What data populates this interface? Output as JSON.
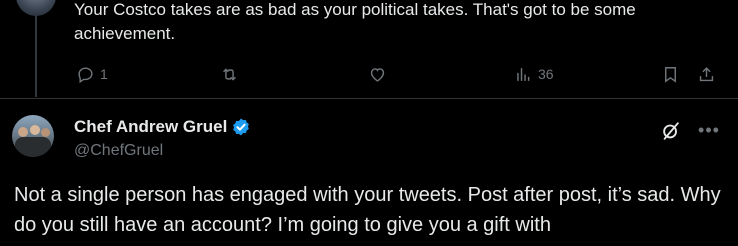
{
  "previous_reply": {
    "text": "Your Costco takes are as bad as your political takes. That's got to be some achievement.",
    "actions": {
      "reply_count": "1",
      "views_count": "36"
    }
  },
  "post": {
    "author_name": "Chef Andrew Gruel",
    "handle": "@ChefGruel",
    "text": "Not a single person has engaged with your tweets. Post after post, it’s sad. Why do you still have an account? I’m going to give you a gift with"
  },
  "icons": {
    "reply": "reply-icon",
    "repost": "repost-icon",
    "like": "heart-icon",
    "views": "views-icon",
    "bookmark": "bookmark-icon",
    "share": "share-icon",
    "verified": "verified-badge-icon",
    "grok": "grok-icon",
    "more": "more-icon"
  },
  "colors": {
    "background": "#000000",
    "text": "#e7e9ea",
    "muted": "#71767b",
    "verified": "#1d9bf0"
  }
}
